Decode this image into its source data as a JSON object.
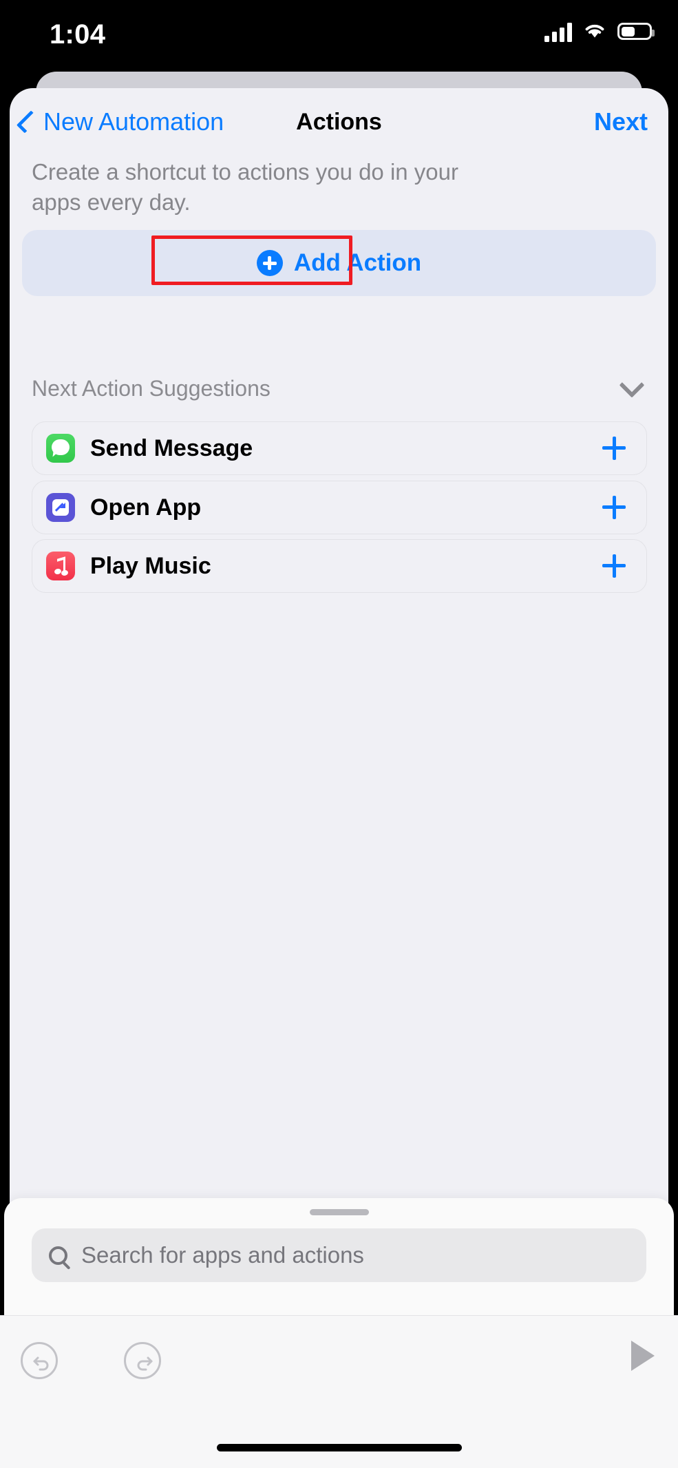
{
  "status_bar": {
    "time": "1:04",
    "cellular_icon": "cellular-signal-icon",
    "wifi_icon": "wifi-icon",
    "battery_icon": "battery-icon"
  },
  "nav": {
    "back_label": "New Automation",
    "back_icon": "chevron-left-icon",
    "title": "Actions",
    "next_label": "Next"
  },
  "main": {
    "description": "Create a shortcut to actions you do in your apps every day.",
    "add_action": {
      "label": "Add Action",
      "icon": "plus-circle-icon",
      "accent_color": "#0a7cff",
      "panel_color": "#e0e5f3",
      "highlight_color": "#ef1c22"
    },
    "suggestions": {
      "title": "Next Action Suggestions",
      "collapse_icon": "chevron-down-icon",
      "items": [
        {
          "label": "Send Message",
          "icon": "messages-app-icon",
          "icon_color": "#4cd964",
          "add_icon": "plus-icon"
        },
        {
          "label": "Open App",
          "icon": "open-app-icon",
          "icon_color": "#5b54d6",
          "add_icon": "plus-icon"
        },
        {
          "label": "Play Music",
          "icon": "music-app-icon",
          "icon_color": "#f23049",
          "add_icon": "plus-icon"
        }
      ]
    }
  },
  "bottom_sheet": {
    "grab_handle": "sheet-grab-handle",
    "search": {
      "placeholder": "Search for apps and actions",
      "value": "",
      "icon": "search-icon"
    }
  },
  "toolbar": {
    "undo_icon": "undo-icon",
    "redo_icon": "redo-icon",
    "run_icon": "play-icon"
  }
}
